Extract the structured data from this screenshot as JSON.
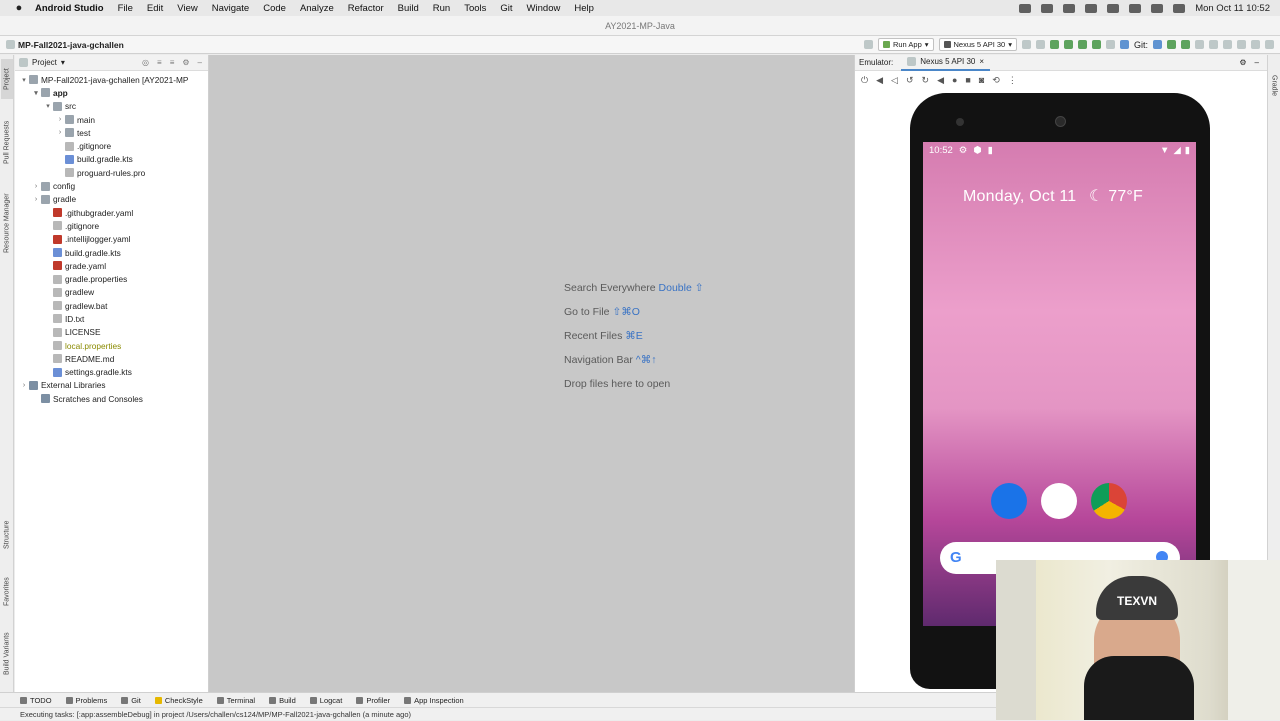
{
  "menubar": {
    "items": [
      "Android Studio",
      "File",
      "Edit",
      "View",
      "Navigate",
      "Code",
      "Analyze",
      "Refactor",
      "Build",
      "Run",
      "Tools",
      "Git",
      "Window",
      "Help"
    ],
    "clock": "Mon Oct 11  10:52"
  },
  "window": {
    "title": "AY2021-MP-Java"
  },
  "toolbar": {
    "breadcrumb": "MP-Fall2021-java-gchallen",
    "run_config": "Run App",
    "device": "Nexus 5 API 30",
    "git_label": "Git:"
  },
  "left_strip": {
    "tabs": [
      "Project",
      "Pull Requests",
      "Resource Manager",
      "Structure",
      "Favorites",
      "Build Variants"
    ]
  },
  "project": {
    "view_label": "Project",
    "tree": [
      {
        "label": "MP-Fall2021-java-gchallen [AY2021-MP",
        "indent": 0,
        "arrow": "▾",
        "icon": "folder",
        "bold": false
      },
      {
        "label": "app",
        "indent": 1,
        "arrow": "▾",
        "icon": "folder",
        "bold": true
      },
      {
        "label": "src",
        "indent": 2,
        "arrow": "▾",
        "icon": "folder",
        "bold": false
      },
      {
        "label": "main",
        "indent": 3,
        "arrow": "›",
        "icon": "folder",
        "bold": false
      },
      {
        "label": "test",
        "indent": 3,
        "arrow": "›",
        "icon": "folder",
        "bold": false
      },
      {
        "label": ".gitignore",
        "indent": 3,
        "arrow": "",
        "icon": "file",
        "bold": false
      },
      {
        "label": "build.gradle.kts",
        "indent": 3,
        "arrow": "",
        "icon": "kts",
        "bold": false
      },
      {
        "label": "proguard-rules.pro",
        "indent": 3,
        "arrow": "",
        "icon": "file",
        "bold": false
      },
      {
        "label": "config",
        "indent": 1,
        "arrow": "›",
        "icon": "folder",
        "bold": false
      },
      {
        "label": "gradle",
        "indent": 1,
        "arrow": "›",
        "icon": "folder",
        "bold": false
      },
      {
        "label": ".githubgrader.yaml",
        "indent": 2,
        "arrow": "",
        "icon": "yml",
        "bold": false
      },
      {
        "label": ".gitignore",
        "indent": 2,
        "arrow": "",
        "icon": "file",
        "bold": false
      },
      {
        "label": ".intellijlogger.yaml",
        "indent": 2,
        "arrow": "",
        "icon": "yml",
        "bold": false
      },
      {
        "label": "build.gradle.kts",
        "indent": 2,
        "arrow": "",
        "icon": "kts",
        "bold": false
      },
      {
        "label": "grade.yaml",
        "indent": 2,
        "arrow": "",
        "icon": "yml",
        "bold": false
      },
      {
        "label": "gradle.properties",
        "indent": 2,
        "arrow": "",
        "icon": "file",
        "bold": false
      },
      {
        "label": "gradlew",
        "indent": 2,
        "arrow": "",
        "icon": "file",
        "bold": false
      },
      {
        "label": "gradlew.bat",
        "indent": 2,
        "arrow": "",
        "icon": "file",
        "bold": false
      },
      {
        "label": "ID.txt",
        "indent": 2,
        "arrow": "",
        "icon": "file",
        "bold": false
      },
      {
        "label": "LICENSE",
        "indent": 2,
        "arrow": "",
        "icon": "file",
        "bold": false
      },
      {
        "label": "local.properties",
        "indent": 2,
        "arrow": "",
        "icon": "file",
        "bold": false,
        "muted": true
      },
      {
        "label": "README.md",
        "indent": 2,
        "arrow": "",
        "icon": "file",
        "bold": false
      },
      {
        "label": "settings.gradle.kts",
        "indent": 2,
        "arrow": "",
        "icon": "kts",
        "bold": false
      },
      {
        "label": "External Libraries",
        "indent": 0,
        "arrow": "›",
        "icon": "lib",
        "bold": false
      },
      {
        "label": "Scratches and Consoles",
        "indent": 1,
        "arrow": "",
        "icon": "lib",
        "bold": false
      }
    ]
  },
  "editor": {
    "hints": [
      {
        "text": "Search Everywhere",
        "key": "Double ⇧"
      },
      {
        "text": "Go to File",
        "key": "⇧⌘O"
      },
      {
        "text": "Recent Files",
        "key": "⌘E"
      },
      {
        "text": "Navigation Bar",
        "key": "^⌘↑"
      },
      {
        "text": "Drop files here to open",
        "key": ""
      }
    ]
  },
  "emulator": {
    "label": "Emulator:",
    "tab": "Nexus 5 API 30",
    "phone": {
      "time": "10:52",
      "glance": "Monday, Oct 11",
      "temperature": "77°F"
    }
  },
  "right_strip": {
    "tabs": [
      "Gradle"
    ]
  },
  "bottom": {
    "tabs": [
      "TODO",
      "Problems",
      "Git",
      "CheckStyle",
      "Terminal",
      "Build",
      "Logcat",
      "Profiler",
      "App Inspection"
    ],
    "status": "Executing tasks: [:app:assembleDebug] in project /Users/challen/cs124/MP/MP-Fall2021-java-gchallen (a minute ago)"
  },
  "webcam": {
    "cap_text": "TEXVN"
  }
}
